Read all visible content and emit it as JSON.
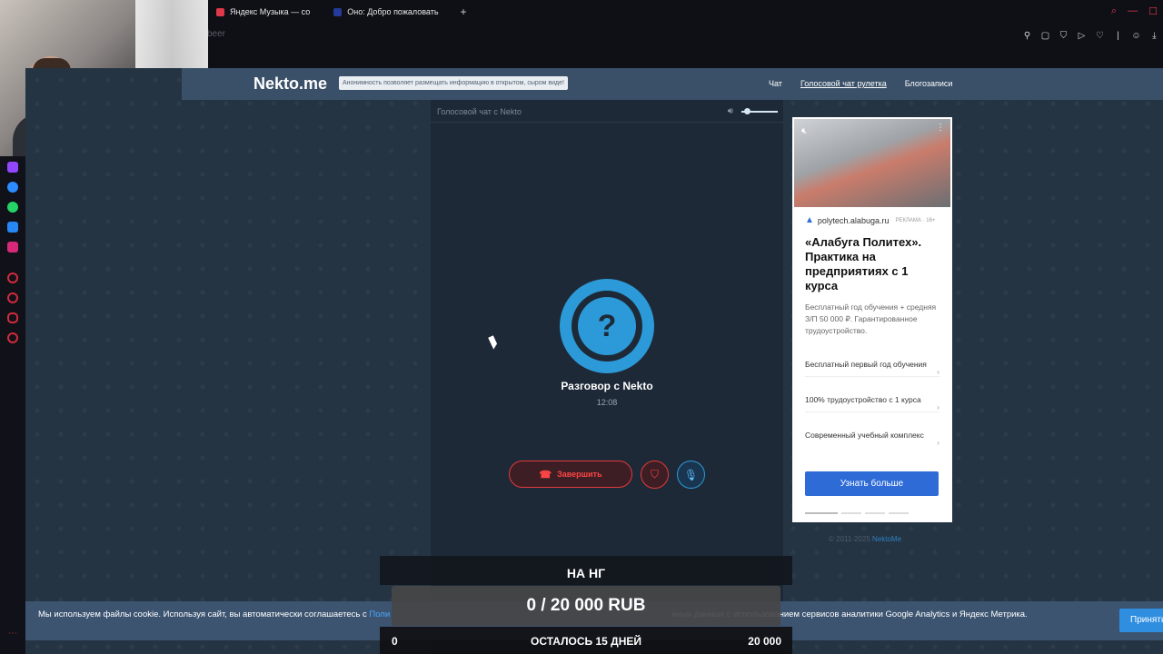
{
  "browser": {
    "tabs": [
      {
        "label": "Яндекс Музыка — со",
        "favicon": "yandex-music-icon"
      },
      {
        "label": "Оно: Добро пожаловать",
        "favicon": "site-icon"
      }
    ],
    "address": "beer"
  },
  "site": {
    "logo": "Nekto.me",
    "slogan": "Анонимность позволяет размещать информацию в открытом, сыром виде!",
    "nav": [
      "Чат",
      "Голосовой чат рулетка",
      "Блогозаписи"
    ]
  },
  "chat": {
    "header": "Голосовой чат с Nekto",
    "volume_level": 0.25,
    "partner_name": "Разговор с Nekto",
    "timer": "12:08",
    "avatar_symbol": "?",
    "end_label": "Завершить"
  },
  "ad": {
    "domain": "polytech.alabuga.ru",
    "tag": "РЕКЛАМА · 16+",
    "title": "«Алабуга Политех». Практика на предприятиях с 1 курса",
    "description": "Бесплатный год обучения + средняя З/П 50 000 ₽. Гарантированное трудоустройство.",
    "items": [
      "Бесплатный первый год обучения",
      "100% трудоустройство с 1 курса",
      "Современный учебный комплекс"
    ],
    "cta": "Узнать больше"
  },
  "copyright": {
    "text": "© 2011-2025",
    "link": "NektoMe"
  },
  "cookie": {
    "text_before": "Мы используем файлы cookie. Используя сайт, вы автоматически соглашаетесь с",
    "link": "Поли",
    "text_after": "нных данных с использованием сервисов аналитики Google Analytics и Яндекс Метрика.",
    "button": "Принять"
  },
  "donation": {
    "title": "НА НГ",
    "amount": "0 / 20 000 RUB",
    "min": "0",
    "remaining": "ОСТАЛОСЬ 15 ДНЕЙ",
    "max": "20 000"
  },
  "colors": {
    "accent": "#2c9ad8",
    "danger": "#e23a3a",
    "header": "#3a5068",
    "background": "#253443",
    "panel": "#1e2937"
  }
}
